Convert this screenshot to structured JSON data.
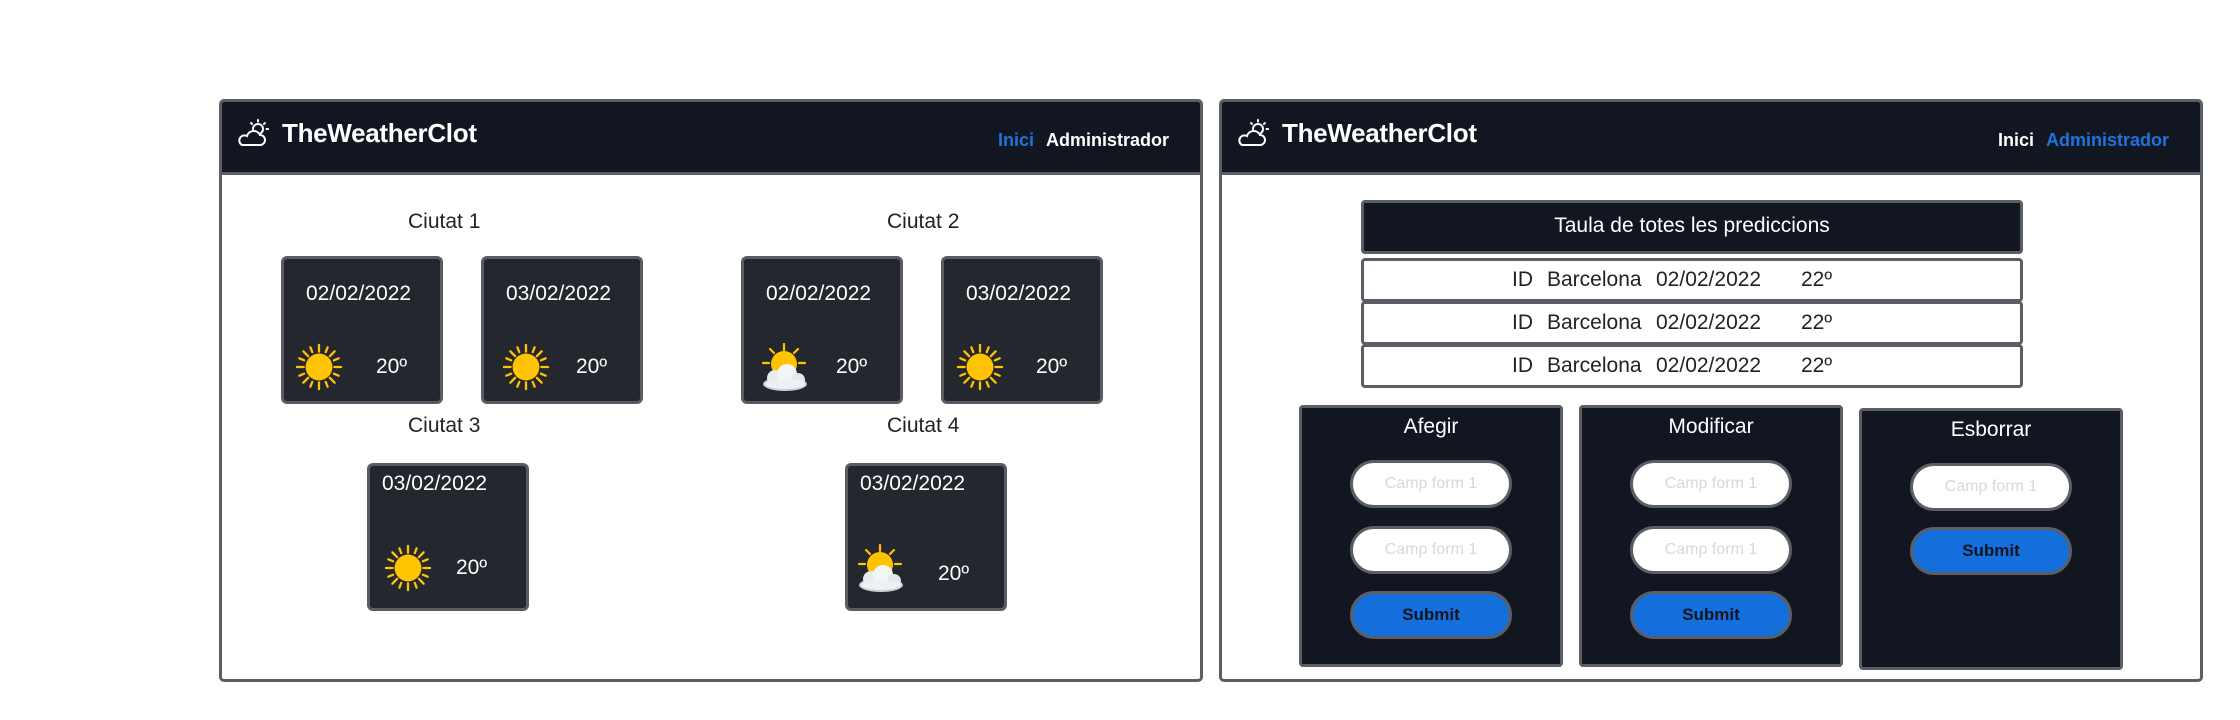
{
  "brand": {
    "name": "TheWeatherClot",
    "logo_icon": "cloud-sun-icon"
  },
  "nav": {
    "home": "Inici",
    "admin": "Administrador"
  },
  "colors": {
    "navbar": "#111620",
    "accent": "#1c74dc",
    "card": "#24272d",
    "sun": "#ffc300",
    "border": "#5b5e64"
  },
  "cities": [
    {
      "title": "Ciutat 1",
      "forecasts": [
        {
          "date": "02/02/2022",
          "temp": "20º",
          "icon": "sun-icon"
        },
        {
          "date": "03/02/2022",
          "temp": "20º",
          "icon": "sun-icon"
        }
      ]
    },
    {
      "title": "Ciutat 2",
      "forecasts": [
        {
          "date": "02/02/2022",
          "temp": "20º",
          "icon": "sun-cloud-icon"
        },
        {
          "date": "03/02/2022",
          "temp": "20º",
          "icon": "sun-icon"
        }
      ]
    },
    {
      "title": "Ciutat 3",
      "forecasts": [
        {
          "date": "03/02/2022",
          "temp": "20º",
          "icon": "sun-icon"
        }
      ]
    },
    {
      "title": "Ciutat 4",
      "forecasts": [
        {
          "date": "03/02/2022",
          "temp": "20º",
          "icon": "sun-cloud-icon"
        }
      ]
    }
  ],
  "admin": {
    "table_title": "Taula de totes les prediccions",
    "rows": [
      {
        "id": "ID",
        "city": "Barcelona",
        "date": "02/02/2022",
        "temp": "22º"
      },
      {
        "id": "ID",
        "city": "Barcelona",
        "date": "02/02/2022",
        "temp": "22º"
      },
      {
        "id": "ID",
        "city": "Barcelona",
        "date": "02/02/2022",
        "temp": "22º"
      }
    ],
    "forms": [
      {
        "title": "Afegir",
        "fields": [
          "Camp form 1",
          "Camp form 1"
        ],
        "submit": "Submit"
      },
      {
        "title": "Modificar",
        "fields": [
          "Camp form 1",
          "Camp form 1"
        ],
        "submit": "Submit"
      },
      {
        "title": "Esborrar",
        "fields": [
          "Camp form 1"
        ],
        "submit": "Submit"
      }
    ]
  }
}
